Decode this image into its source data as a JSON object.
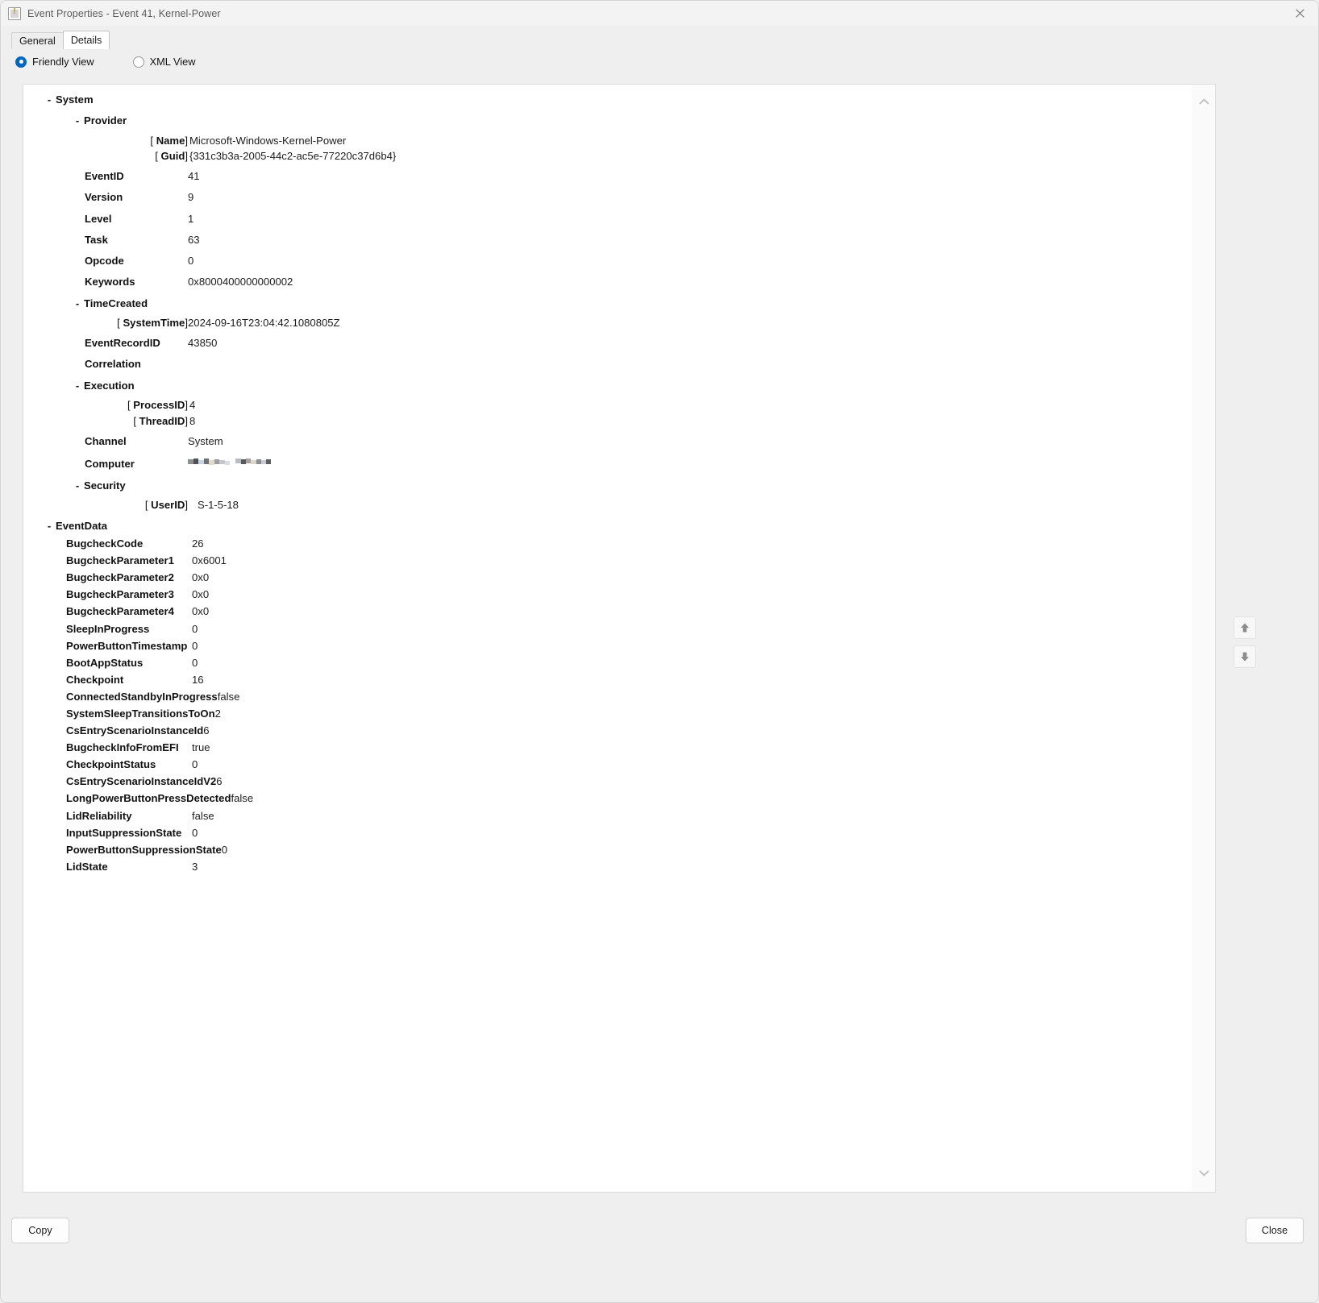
{
  "window": {
    "title": "Event Properties - Event 41, Kernel-Power",
    "icon": "event-properties-icon",
    "close_icon": "close-icon"
  },
  "tabs": [
    {
      "label": "General",
      "selected": false
    },
    {
      "label": "Details",
      "selected": true
    }
  ],
  "view_options": [
    {
      "label": "Friendly View",
      "selected": true
    },
    {
      "label": "XML View",
      "selected": false
    }
  ],
  "tree": {
    "system_label": "System",
    "provider_label": "Provider",
    "timecreated_label": "TimeCreated",
    "execution_label": "Execution",
    "security_label": "Security",
    "eventdata_label": "EventData",
    "collapse_marker": "-",
    "provider_attrs": [
      {
        "name": "Name",
        "value": "Microsoft-Windows-Kernel-Power"
      },
      {
        "name": "Guid",
        "value": "{331c3b3a-2005-44c2-ac5e-77220c37d6b4}"
      }
    ],
    "system_rows": [
      {
        "label": "EventID",
        "value": "41"
      },
      {
        "label": "Version",
        "value": "9"
      },
      {
        "label": "Level",
        "value": "1"
      },
      {
        "label": "Task",
        "value": "63"
      },
      {
        "label": "Opcode",
        "value": "0"
      },
      {
        "label": "Keywords",
        "value": "0x8000400000000002"
      }
    ],
    "timecreated_attrs": [
      {
        "name": "SystemTime",
        "value": "2024-09-16T23:04:42.1080805Z"
      }
    ],
    "system_rows_2": [
      {
        "label": "EventRecordID",
        "value": "43850"
      },
      {
        "label": "Correlation",
        "value": ""
      }
    ],
    "execution_attrs": [
      {
        "name": "ProcessID",
        "value": "4"
      },
      {
        "name": "ThreadID",
        "value": "8"
      }
    ],
    "system_rows_3": [
      {
        "label": "Channel",
        "value": "System"
      },
      {
        "label": "Computer",
        "value": "",
        "redacted": true
      }
    ],
    "security_attrs": [
      {
        "name": "UserID",
        "value": "S-1-5-18"
      }
    ],
    "eventdata_rows": [
      {
        "label": "BugcheckCode",
        "value": "26"
      },
      {
        "label": "BugcheckParameter1",
        "value": "0x6001"
      },
      {
        "label": "BugcheckParameter2",
        "value": "0x0"
      },
      {
        "label": "BugcheckParameter3",
        "value": "0x0"
      },
      {
        "label": "BugcheckParameter4",
        "value": "0x0"
      },
      {
        "label": "SleepInProgress",
        "value": "0"
      },
      {
        "label": "PowerButtonTimestamp",
        "value": "0"
      },
      {
        "label": "BootAppStatus",
        "value": "0"
      },
      {
        "label": "Checkpoint",
        "value": "16"
      },
      {
        "label": "ConnectedStandbyInProgress",
        "value": "false"
      },
      {
        "label": "SystemSleepTransitionsToOn",
        "value": "2"
      },
      {
        "label": "CsEntryScenarioInstanceId",
        "value": "6"
      },
      {
        "label": "BugcheckInfoFromEFI",
        "value": "true"
      },
      {
        "label": "CheckpointStatus",
        "value": "0"
      },
      {
        "label": "CsEntryScenarioInstanceIdV2",
        "value": "6"
      },
      {
        "label": "LongPowerButtonPressDetected",
        "value": "false"
      },
      {
        "label": "LidReliability",
        "value": "false"
      },
      {
        "label": "InputSuppressionState",
        "value": "0"
      },
      {
        "label": "PowerButtonSuppressionState",
        "value": "0"
      },
      {
        "label": "LidState",
        "value": "3"
      }
    ]
  },
  "scrollbar": {
    "up_icon": "chevron-up-icon",
    "down_icon": "chevron-down-icon"
  },
  "sidenav": [
    {
      "icon": "arrow-up-icon",
      "name": "previous-event-button"
    },
    {
      "icon": "arrow-down-icon",
      "name": "next-event-button"
    }
  ],
  "footer": {
    "copy_label": "Copy",
    "close_label": "Close"
  },
  "colors": {
    "accent": "#0067c0",
    "dialog_bg": "#efefef",
    "panel_bg": "#ffffff",
    "text": "#131313"
  }
}
